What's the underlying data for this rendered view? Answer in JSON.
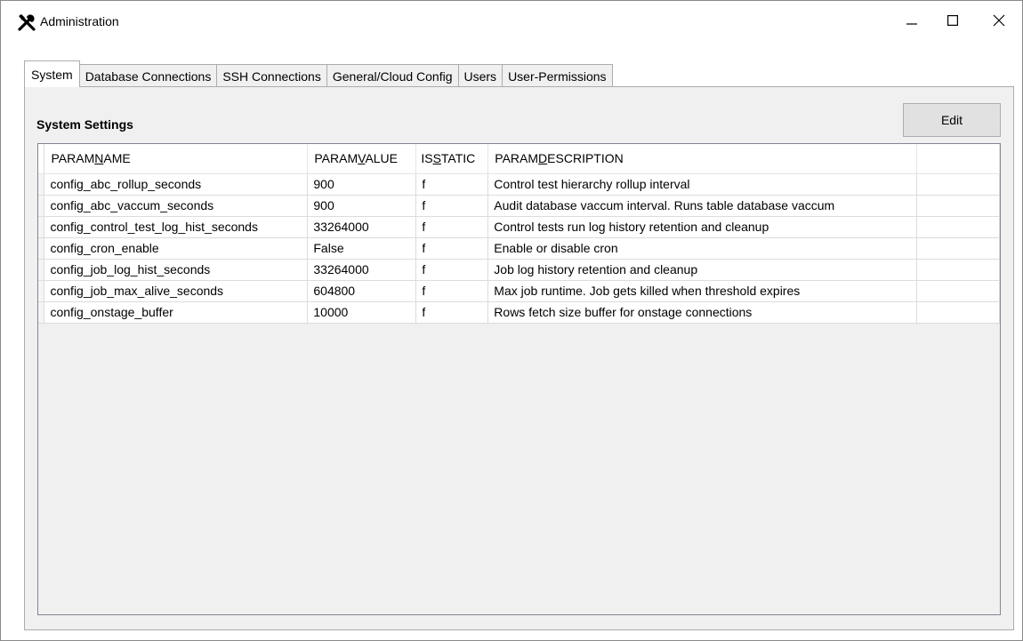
{
  "window": {
    "title": "Administration",
    "icon": "tools-icon",
    "controls": [
      "minimize-icon",
      "maximize-icon",
      "close-icon"
    ]
  },
  "tabs": [
    {
      "label": "System",
      "active": true
    },
    {
      "label": "Database Connections",
      "active": false
    },
    {
      "label": "SSH Connections",
      "active": false
    },
    {
      "label": "General/Cloud Config",
      "active": false
    },
    {
      "label": "Users",
      "active": false
    },
    {
      "label": "User-Permissions",
      "active": false
    }
  ],
  "system": {
    "title": "System Settings",
    "edit_label": "Edit",
    "columns": [
      {
        "pre": "PARAM",
        "key": "N",
        "post": "AME"
      },
      {
        "pre": "PARAM",
        "key": "V",
        "post": "ALUE"
      },
      {
        "pre": "IS",
        "key": "S",
        "post": "TATIC"
      },
      {
        "pre": "PARAM",
        "key": "D",
        "post": "ESCRIPTION"
      }
    ],
    "rows": [
      [
        "config_abc_rollup_seconds",
        "900",
        "f",
        "Control test hierarchy rollup interval"
      ],
      [
        "config_abc_vaccum_seconds",
        "900",
        "f",
        "Audit database vaccum interval. Runs table database vaccum"
      ],
      [
        "config_control_test_log_hist_seconds",
        "33264000",
        "f",
        "Control tests run log history retention and cleanup"
      ],
      [
        "config_cron_enable",
        "False",
        "f",
        "Enable or disable cron"
      ],
      [
        "config_job_log_hist_seconds",
        "33264000",
        "f",
        "Job log history retention and cleanup"
      ],
      [
        "config_job_max_alive_seconds",
        "604800",
        "f",
        "Max job runtime. Job gets killed when threshold expires"
      ],
      [
        "config_onstage_buffer",
        "10000",
        "f",
        "Rows fetch size buffer for onstage connections"
      ]
    ]
  }
}
